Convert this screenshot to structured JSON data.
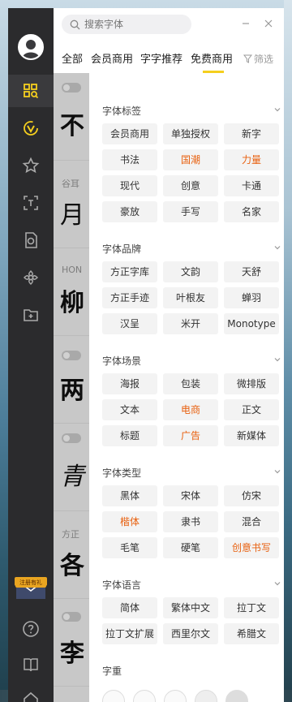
{
  "search": {
    "placeholder": "搜索字体"
  },
  "tabs": [
    {
      "label": "全部"
    },
    {
      "label": "会员商用"
    },
    {
      "label": "字字推荐"
    },
    {
      "label": "免费商用"
    }
  ],
  "filter_label": "筛选",
  "active_tab": "免费商用",
  "promo_label": "注册有礼",
  "sidebar_icons": [
    "avatar",
    "grid-search-icon",
    "v-icon",
    "star-icon",
    "scan-icon",
    "font-file-icon",
    "flower-icon",
    "folder-plus-icon",
    "help-icon",
    "book-icon",
    "home-icon"
  ],
  "font_list": [
    {
      "name": "",
      "preview": "不"
    },
    {
      "name": "谷耳",
      "preview": "月"
    },
    {
      "name": "HON",
      "preview": "柳"
    },
    {
      "name": "",
      "preview": "两"
    },
    {
      "name": "",
      "preview": "青"
    },
    {
      "name": "方正",
      "preview": "各"
    },
    {
      "name": "",
      "preview": "李"
    }
  ],
  "sections": [
    {
      "title": "字体标签",
      "items": [
        {
          "label": "会员商用",
          "highlight": false
        },
        {
          "label": "单独授权",
          "highlight": false
        },
        {
          "label": "新字",
          "highlight": false
        },
        {
          "label": "书法",
          "highlight": false
        },
        {
          "label": "国潮",
          "highlight": true
        },
        {
          "label": "力量",
          "highlight": true
        },
        {
          "label": "现代",
          "highlight": false
        },
        {
          "label": "创意",
          "highlight": false
        },
        {
          "label": "卡通",
          "highlight": false
        },
        {
          "label": "豪放",
          "highlight": false
        },
        {
          "label": "手写",
          "highlight": false
        },
        {
          "label": "名家",
          "highlight": false
        }
      ]
    },
    {
      "title": "字体品牌",
      "items": [
        {
          "label": "方正字库",
          "highlight": false
        },
        {
          "label": "文韵",
          "highlight": false
        },
        {
          "label": "天舒",
          "highlight": false
        },
        {
          "label": "方正手迹",
          "highlight": false
        },
        {
          "label": "叶根友",
          "highlight": false
        },
        {
          "label": "蝉羽",
          "highlight": false
        },
        {
          "label": "汉呈",
          "highlight": false
        },
        {
          "label": "米开",
          "highlight": false
        },
        {
          "label": "Monotype",
          "highlight": false
        }
      ]
    },
    {
      "title": "字体场景",
      "items": [
        {
          "label": "海报",
          "highlight": false
        },
        {
          "label": "包装",
          "highlight": false
        },
        {
          "label": "微排版",
          "highlight": false
        },
        {
          "label": "文本",
          "highlight": false
        },
        {
          "label": "电商",
          "highlight": true
        },
        {
          "label": "正文",
          "highlight": false
        },
        {
          "label": "标题",
          "highlight": false
        },
        {
          "label": "广告",
          "highlight": true
        },
        {
          "label": "新媒体",
          "highlight": false
        }
      ]
    },
    {
      "title": "字体类型",
      "items": [
        {
          "label": "黑体",
          "highlight": false
        },
        {
          "label": "宋体",
          "highlight": false
        },
        {
          "label": "仿宋",
          "highlight": false
        },
        {
          "label": "楷体",
          "highlight": true
        },
        {
          "label": "隶书",
          "highlight": false
        },
        {
          "label": "混合",
          "highlight": false
        },
        {
          "label": "毛笔",
          "highlight": false
        },
        {
          "label": "硬笔",
          "highlight": false
        },
        {
          "label": "创意书写",
          "highlight": true
        }
      ]
    },
    {
      "title": "字体语言",
      "items": [
        {
          "label": "简体",
          "highlight": false
        },
        {
          "label": "繁体中文",
          "highlight": false
        },
        {
          "label": "拉丁文",
          "highlight": false
        },
        {
          "label": "拉丁文扩展",
          "highlight": false
        },
        {
          "label": "西里尔文",
          "highlight": false
        },
        {
          "label": "希腊文",
          "highlight": false
        }
      ]
    }
  ],
  "weight_title": "字重",
  "colors": {
    "accent": "#f5cf1e",
    "highlight": "#e8600f",
    "sidebar": "#2b2b2d"
  }
}
